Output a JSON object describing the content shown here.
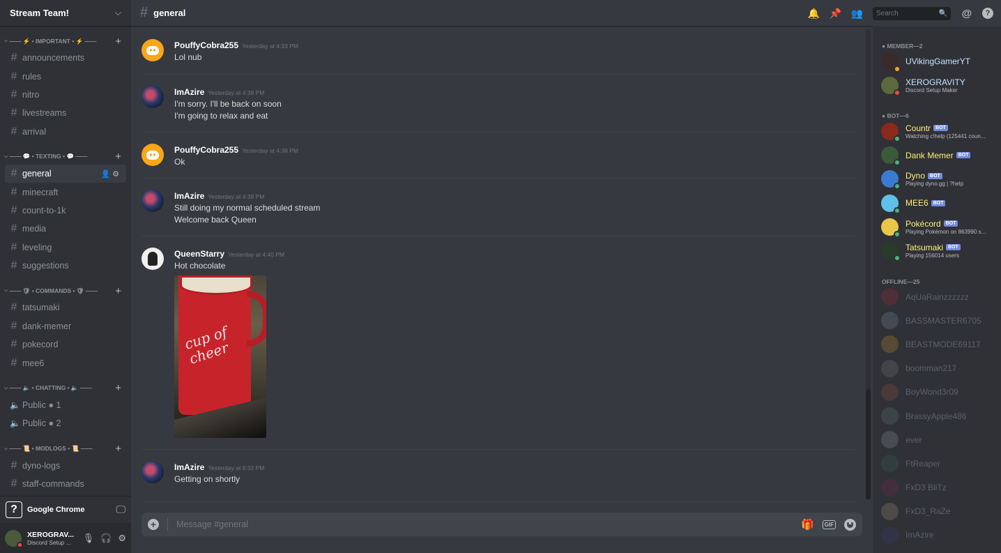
{
  "server": {
    "name": "Stream Team!"
  },
  "sidebar": {
    "categories": [
      {
        "label": "—— ⚡ • IMPORTANT • ⚡ ——",
        "channels": [
          "announcements",
          "rules",
          "nitro",
          "livestreams",
          "arrival"
        ]
      },
      {
        "label": "—— 💬 • TEXTING • 💬 ——",
        "channels": [
          "general",
          "minecraft",
          "count-to-1k",
          "media",
          "leveling",
          "suggestions"
        ]
      },
      {
        "label": "—— 🛡 • COMMANDS • 🛡 ——",
        "channels": [
          "tatsumaki",
          "dank-memer",
          "pokecord",
          "mee6"
        ]
      },
      {
        "label": "—— 🔈 • CHATTING • 🔈 ——",
        "channels": [
          "Public ● 1",
          "Public ● 2"
        ]
      },
      {
        "label": "—— 📜 • MODLOGS • 📜 ——",
        "channels": [
          "dyno-logs",
          "staff-commands"
        ]
      }
    ],
    "active_channel": "general"
  },
  "activity": {
    "label": "Google Chrome"
  },
  "user_panel": {
    "name": "XEROGRAV...",
    "status": "Discord Setup ..."
  },
  "channel_header": {
    "title": "general"
  },
  "search": {
    "placeholder": "Search"
  },
  "messages": [
    {
      "author": "PouffyCobra255",
      "time": "Yesterday at 4:33 PM",
      "lines": [
        "Lol nub"
      ],
      "avatar": "discord-orange"
    },
    {
      "author": "ImAzire",
      "time": "Yesterday at 4:38 PM",
      "lines": [
        "I'm sorry. I'll be back on soon",
        "I'm going to relax and eat"
      ],
      "avatar": "spiderman"
    },
    {
      "author": "PouffyCobra255",
      "time": "Yesterday at 4:38 PM",
      "lines": [
        "Ok"
      ],
      "avatar": "discord-orange"
    },
    {
      "author": "ImAzire",
      "time": "Yesterday at 4:38 PM",
      "lines": [
        "Still doing my normal scheduled stream",
        "Welcome back Queen"
      ],
      "avatar": "spiderman"
    },
    {
      "author": "QueenStarry",
      "time": "Yesterday at 4:40 PM",
      "lines": [
        "Hot chocolate"
      ],
      "avatar": "queen",
      "attachment": {
        "mug_text": "cup of cheer"
      }
    },
    {
      "author": "ImAzire",
      "time": "Yesterday at 6:32 PM",
      "lines": [
        "Getting on shortly"
      ],
      "avatar": "spiderman"
    }
  ],
  "composer": {
    "placeholder": "Message #general",
    "gif_label": "GIF"
  },
  "members": {
    "groups": [
      {
        "label": "● MEMBER—2",
        "items": [
          {
            "name": "UVikingGamerYT",
            "status": "idle",
            "sub": "",
            "color": "#c9e6ff",
            "bot": false
          },
          {
            "name": "XEROGRAVITY",
            "status": "dnd",
            "sub": "Discord Setup Maker",
            "color": "#c9e6ff",
            "bot": false
          }
        ]
      },
      {
        "label": "● BOT—6",
        "items": [
          {
            "name": "Countr",
            "status": "online",
            "sub": "Watching c!help (125441 coun...",
            "color": "#fff07a",
            "bot": true
          },
          {
            "name": "Dank Memer",
            "status": "online",
            "sub": "",
            "color": "#fff07a",
            "bot": true
          },
          {
            "name": "Dyno",
            "status": "online",
            "sub": "Playing dyno.gg | ?help",
            "color": "#fff07a",
            "bot": true
          },
          {
            "name": "MEE6",
            "status": "online",
            "sub": "",
            "color": "#fff07a",
            "bot": true
          },
          {
            "name": "Pokécord",
            "status": "online",
            "sub": "Playing Pokémon on 863990 s...",
            "color": "#fff07a",
            "bot": true
          },
          {
            "name": "Tatsumaki",
            "status": "online",
            "sub": "Playing 156014 users",
            "color": "#fff07a",
            "bot": true
          }
        ]
      },
      {
        "label": "OFFLINE—25",
        "items": [
          {
            "name": "AqUaRainzzzzzz",
            "offline": true
          },
          {
            "name": "BASSMASTER6705",
            "offline": true
          },
          {
            "name": "BEASTMODE69117",
            "offline": true
          },
          {
            "name": "boomman217",
            "offline": true
          },
          {
            "name": "BoyWond3r09",
            "offline": true
          },
          {
            "name": "BrassyApple486",
            "offline": true
          },
          {
            "name": "ever",
            "offline": true
          },
          {
            "name": "FtReaper",
            "offline": true
          },
          {
            "name": "FxD3 BliTz",
            "offline": true
          },
          {
            "name": "FxD3_RaZe",
            "offline": true
          },
          {
            "name": "ImAzire",
            "offline": true
          }
        ]
      }
    ],
    "bot_badge": "BOT"
  },
  "colors": {
    "accent": "#7289da",
    "online": "#43b581",
    "dnd": "#f04747",
    "idle": "#faa61a"
  }
}
